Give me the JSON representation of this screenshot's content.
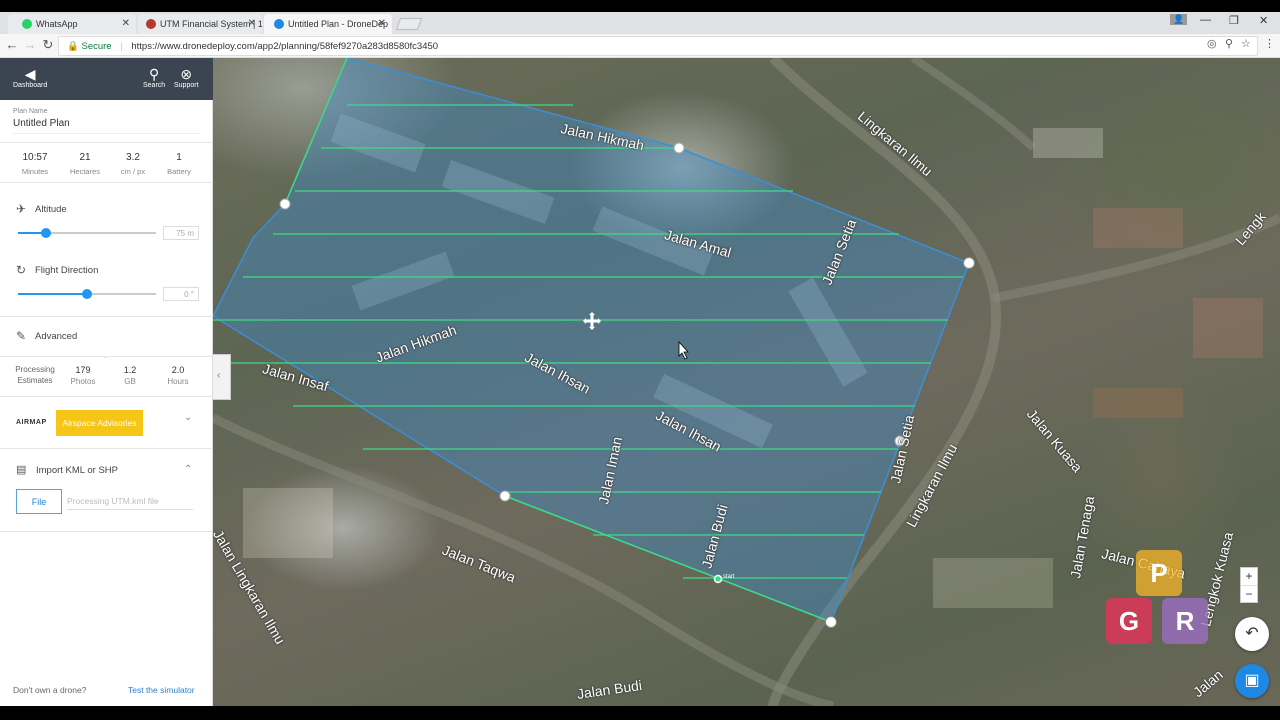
{
  "browser": {
    "tabs": [
      {
        "title": "WhatsApp",
        "favicon_color": "#25d366"
      },
      {
        "title": "UTM Financial System | 1",
        "favicon_color": "#b23a2e"
      },
      {
        "title": "Untitled Plan - DroneDep",
        "favicon_color": "#1e88e5"
      }
    ],
    "active_tab": 2,
    "secure_label": "Secure",
    "url": "https://www.dronedeploy.com/app2/planning/58fef9270a283d8580fc3450"
  },
  "sidebar": {
    "dashboard_label": "Dashboard",
    "search_label": "Search",
    "support_label": "Support",
    "plan_name_label": "Plan Name",
    "plan_name": "Untitled Plan",
    "stats": [
      {
        "value": "10:57",
        "label": "Minutes"
      },
      {
        "value": "21",
        "label": "Hectares"
      },
      {
        "value": "3.2",
        "label": "cm / px"
      },
      {
        "value": "1",
        "label": "Battery"
      }
    ],
    "altitude": {
      "label": "Altitude",
      "value": "75 m",
      "level": 0.2
    },
    "flight_direction": {
      "label": "Flight Direction",
      "value": "0 °",
      "level": 0.5
    },
    "advanced_label": "Advanced",
    "processing": {
      "label_line1": "Processing",
      "label_line2": "Estimates",
      "items": [
        {
          "value": "179",
          "label": "Photos"
        },
        {
          "value": "1.2",
          "label": "GB"
        },
        {
          "value": "2.0",
          "label": "Hours"
        }
      ]
    },
    "airmap_label": "AIRMAP",
    "airspace_label": "Airspace Advisories",
    "import_label": "Import KML or SHP",
    "file_button": "File",
    "file_placeholder": "Processing UTM.kml file",
    "footer_question": "Don't own a drone?",
    "footer_link": "Test the simulator"
  },
  "map": {
    "streets": [
      "Jalan Hikmah",
      "Jalan Amal",
      "Jalan Setia",
      "Lingkaran Ilmu",
      "Jalan Hikmah",
      "Jalan Ihsan",
      "Jalan Insaf",
      "Jalan Ihsan",
      "Jalan Iman",
      "Jalan Budi",
      "Jalan Setia",
      "Lingkaran Ilmu",
      "Jalan Kuasa",
      "Jalan Tenaga",
      "Jalan Lingkaran Ilmu",
      "Jalan Taqwa",
      "Jalan Budi",
      "Jalan Cahaya",
      "Lengkok Kuasa",
      "Lengk",
      "Jalan"
    ],
    "start_label": "start",
    "zoom_in": "+",
    "zoom_out": "−",
    "watermark_letters": [
      "P",
      "G",
      "R"
    ],
    "polygon_color": "#3b8fd6",
    "flight_line_color": "#3ddc84"
  }
}
